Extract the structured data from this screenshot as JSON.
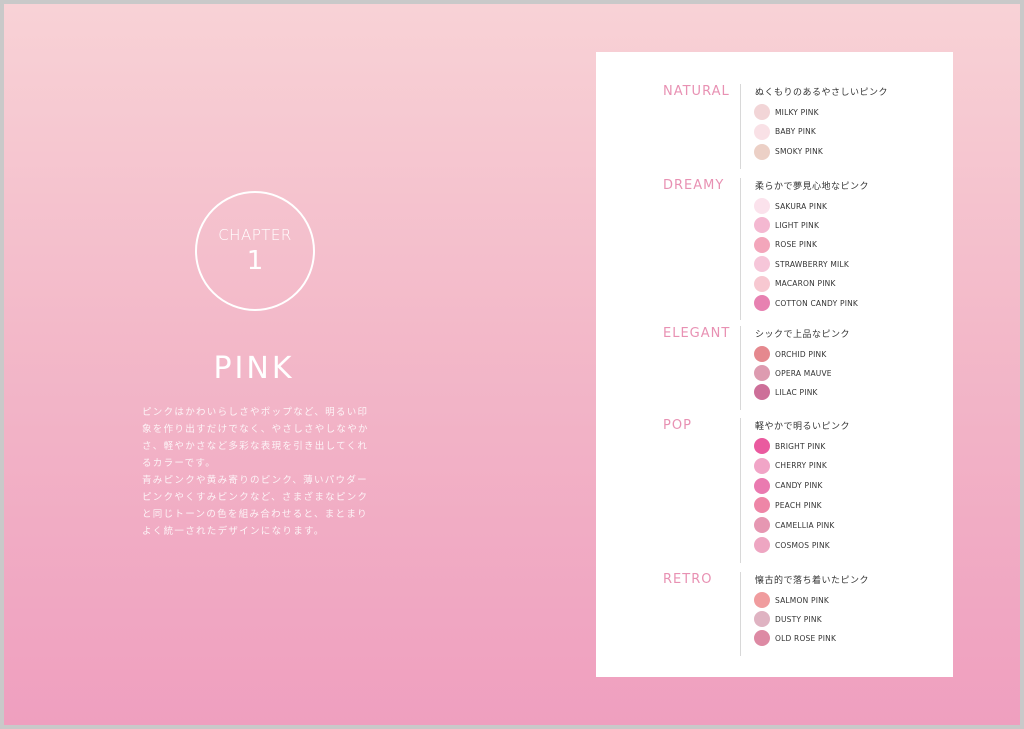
{
  "chapter": {
    "label": "CHAPTER",
    "number": "1"
  },
  "title": "PINK",
  "body_lines": [
    "ピンクはかわいらしさやポップなど、明るい印",
    "象を作り出すだけでなく、やさしさやしなやか",
    "さ、軽やかさなど多彩な表現を引き出してくれ",
    "るカラーです。",
    "青みピンクや黄み寄りのピンク、薄いパウダー",
    "ピンクやくすみピンクなど、さまざまなピンク",
    "と同じトーンの色を組み合わせると、まとまり",
    "よく統一されたデザインになります。"
  ],
  "groups": [
    {
      "name": "NATURAL",
      "description": "ぬくもりのあるやさしいピンク",
      "swatches": [
        {
          "label": "MILKY PINK",
          "color": "#f2d5d7"
        },
        {
          "label": "BABY PINK",
          "color": "#f9e1e6"
        },
        {
          "label": "SMOKY PINK",
          "color": "#ecd0c6"
        }
      ]
    },
    {
      "name": "DREAMY",
      "description": "柔らかで夢見心地なピンク",
      "swatches": [
        {
          "label": "SAKURA PINK",
          "color": "#fbe2ec"
        },
        {
          "label": "LIGHT PINK",
          "color": "#f4b8d1"
        },
        {
          "label": "ROSE PINK",
          "color": "#f3a6bb"
        },
        {
          "label": "STRAWBERRY MILK",
          "color": "#f6c6d9"
        },
        {
          "label": "MACARON PINK",
          "color": "#f7c8d1"
        },
        {
          "label": "COTTON CANDY PINK",
          "color": "#e781b1"
        }
      ]
    },
    {
      "name": "ELEGANT",
      "description": "シックで上品なピンク",
      "swatches": [
        {
          "label": "ORCHID PINK",
          "color": "#e5888e"
        },
        {
          "label": "OPERA MAUVE",
          "color": "#dd9bb0"
        },
        {
          "label": "LILAC PINK",
          "color": "#cd6f99"
        }
      ]
    },
    {
      "name": "POP",
      "description": "軽やかで明るいピンク",
      "swatches": [
        {
          "label": "BRIGHT PINK",
          "color": "#ea5a9f"
        },
        {
          "label": "CHERRY PINK",
          "color": "#f1a5c7"
        },
        {
          "label": "CANDY PINK",
          "color": "#ea7ab0"
        },
        {
          "label": "PEACH PINK",
          "color": "#ee86a7"
        },
        {
          "label": "CAMELLIA PINK",
          "color": "#e697b2"
        },
        {
          "label": "COSMOS PINK",
          "color": "#eea6c2"
        }
      ]
    },
    {
      "name": "RETRO",
      "description": "懐古的で落ち着いたピンク",
      "swatches": [
        {
          "label": "SALMON PINK",
          "color": "#f09c9e"
        },
        {
          "label": "DUSTY PINK",
          "color": "#dfb3c2"
        },
        {
          "label": "OLD ROSE PINK",
          "color": "#dd8aa4"
        }
      ]
    }
  ]
}
